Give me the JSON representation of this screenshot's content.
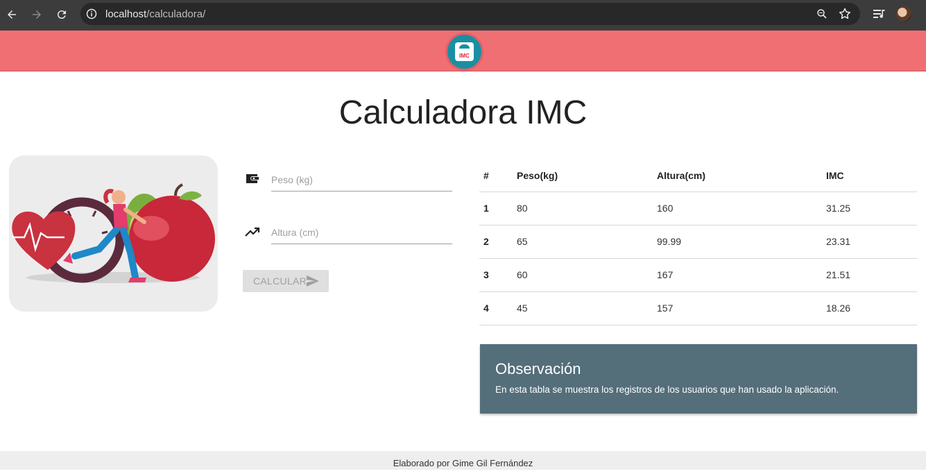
{
  "browser": {
    "url_host": "localhost",
    "url_path": "/calculadora/"
  },
  "header": {
    "logo_text": "IMC"
  },
  "page": {
    "title": "Calculadora IMC"
  },
  "form": {
    "weight_placeholder": "Peso (kg)",
    "height_placeholder": "Altura (cm)",
    "calculate_label": "CALCULAR"
  },
  "table": {
    "headers": [
      "#",
      "Peso(kg)",
      "Altura(cm)",
      "IMC"
    ],
    "rows": [
      [
        "1",
        "80",
        "160",
        "31.25"
      ],
      [
        "2",
        "65",
        "99.99",
        "23.31"
      ],
      [
        "3",
        "60",
        "167",
        "21.51"
      ],
      [
        "4",
        "45",
        "157",
        "18.26"
      ]
    ]
  },
  "observation": {
    "title": "Observación",
    "text": "En esta tabla se muestra los registros de los usuarios que han usado la aplicación."
  },
  "footer": {
    "text": "Elaborado por Gime Gil Fernández"
  },
  "colors": {
    "header_bg": "#ef6f73",
    "card_bg": "#546e7a",
    "chrome_bg": "#3c3c3c"
  }
}
